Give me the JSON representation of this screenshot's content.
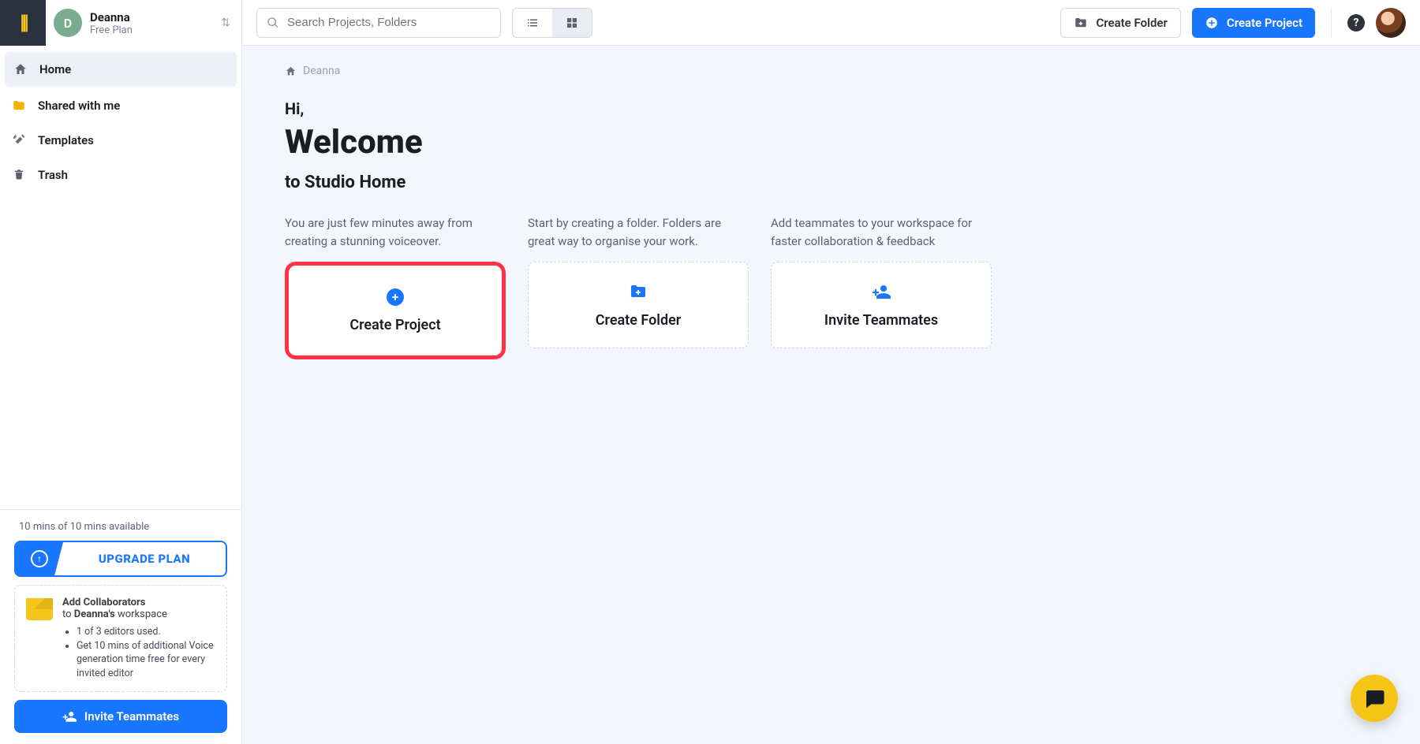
{
  "account": {
    "initial": "D",
    "name": "Deanna",
    "plan": "Free Plan"
  },
  "sidebar": {
    "items": [
      {
        "label": "Home"
      },
      {
        "label": "Shared with me"
      },
      {
        "label": "Templates"
      },
      {
        "label": "Trash"
      }
    ]
  },
  "usage": {
    "mins_label": "10 mins of 10 mins available",
    "upgrade_label": "UPGRADE PLAN"
  },
  "collab": {
    "heading": "Add Collaborators",
    "line_prefix": "to ",
    "owner_possessive": "Deanna's",
    "line_suffix": " workspace",
    "bullet1": "1 of 3 editors used.",
    "bullet2": "Get 10 mins of additional Voice generation time free for every invited editor",
    "invite_label": "Invite Teammates"
  },
  "topbar": {
    "search_placeholder": "Search Projects, Folders",
    "create_folder": "Create Folder",
    "create_project": "Create Project"
  },
  "breadcrumb": {
    "home": "Deanna"
  },
  "hero": {
    "greeting": "Hi,",
    "title": "Welcome",
    "subtitle": "to Studio Home"
  },
  "cards": [
    {
      "desc": "You are just few minutes away from creating a stunning voiceover.",
      "label": "Create Project"
    },
    {
      "desc": "Start by creating a folder. Folders are great way to organise your work.",
      "label": "Create Folder"
    },
    {
      "desc": "Add teammates to your workspace for faster collaboration & feedback",
      "label": "Invite Teammates"
    }
  ]
}
